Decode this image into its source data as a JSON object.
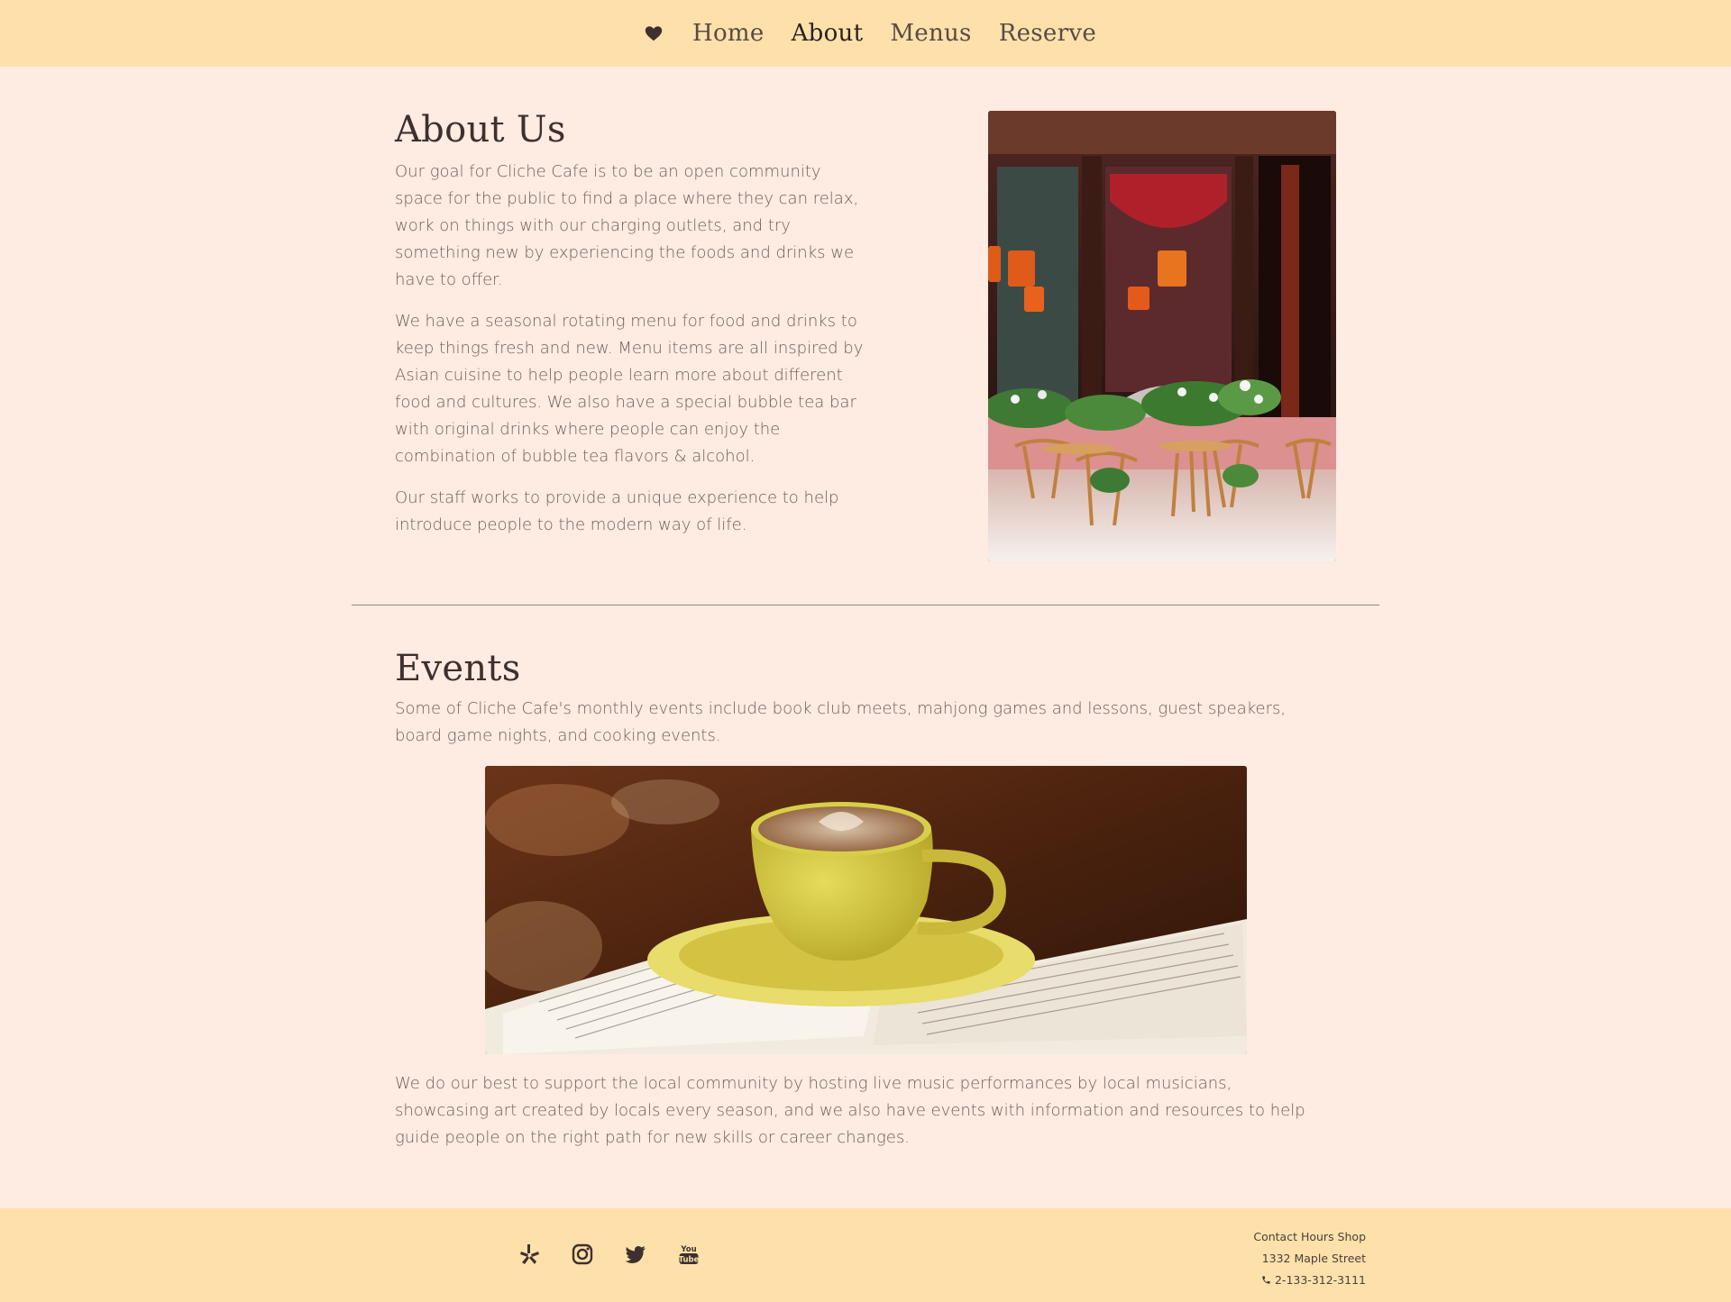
{
  "nav": {
    "items": [
      {
        "label": "Home",
        "active": false
      },
      {
        "label": "About",
        "active": true
      },
      {
        "label": "Menus",
        "active": false
      },
      {
        "label": "Reserve",
        "active": false
      }
    ],
    "icon": "heart-icon"
  },
  "about": {
    "title": "About Us",
    "paragraphs": [
      "Our goal for Cliche Cafe is to be an open community space for the public to find a place where they can relax, work on things with our charging outlets, and try something new by experiencing the foods and drinks we have to offer.",
      "We have a seasonal rotating menu for food and drinks to keep things fresh and new. Menu items are all inspired by Asian cuisine to help people learn more about different food and cultures. We also have a special bubble tea bar with original drinks where people can enjoy the combination of bubble tea flavors & alcohol.",
      "Our staff works to provide a unique experience to help introduce people to the modern way of life."
    ]
  },
  "events": {
    "title": "Events",
    "intro": "Some of Cliche Cafe's monthly events include book club meets, mahjong games and lessons, guest speakers, board game nights, and cooking events.",
    "closing": "We do our best to support the local community by hosting live music performances by local musicians, showcasing art created by locals every season, and we also have events with information and resources to help guide people on the right path for new skills or career changes."
  },
  "footer": {
    "social": [
      "yelp-icon",
      "instagram-icon",
      "twitter-icon",
      "youtube-icon"
    ],
    "contact_links": "Contact Hours Shop",
    "address": "1332 Maple Street",
    "phone": "2-133-312-3111"
  },
  "colors": {
    "background": "#feebe1",
    "bar": "#fee1aa",
    "heading": "#3d302e",
    "body_text": "#6d5f5c"
  }
}
